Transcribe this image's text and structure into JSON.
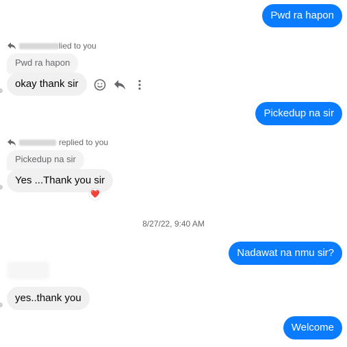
{
  "messages": {
    "out1": "Pwd ra hapon",
    "reply1_suffix": "lied to you",
    "quote1": "Pwd ra hapon",
    "in1": "okay thank sir",
    "out2": "Pickedup na sir",
    "reply2_suffix": "replied to you",
    "quote2": "Pickedup na sir",
    "in2": "Yes ...Thank you sir",
    "timestamp": "8/27/22, 9:40 AM",
    "out3": "Nadawat na nmu sir?",
    "in3": "yes..thank you",
    "out4": "Welcome"
  },
  "reaction": "❤️",
  "icons": {
    "reply": "reply-arrow-icon",
    "react": "smiley-icon",
    "more": "more-vertical-icon"
  },
  "colors": {
    "outgoing_bubble": "#0a7cff",
    "incoming_bubble": "#f0f0f0",
    "meta_text": "#65676b"
  }
}
